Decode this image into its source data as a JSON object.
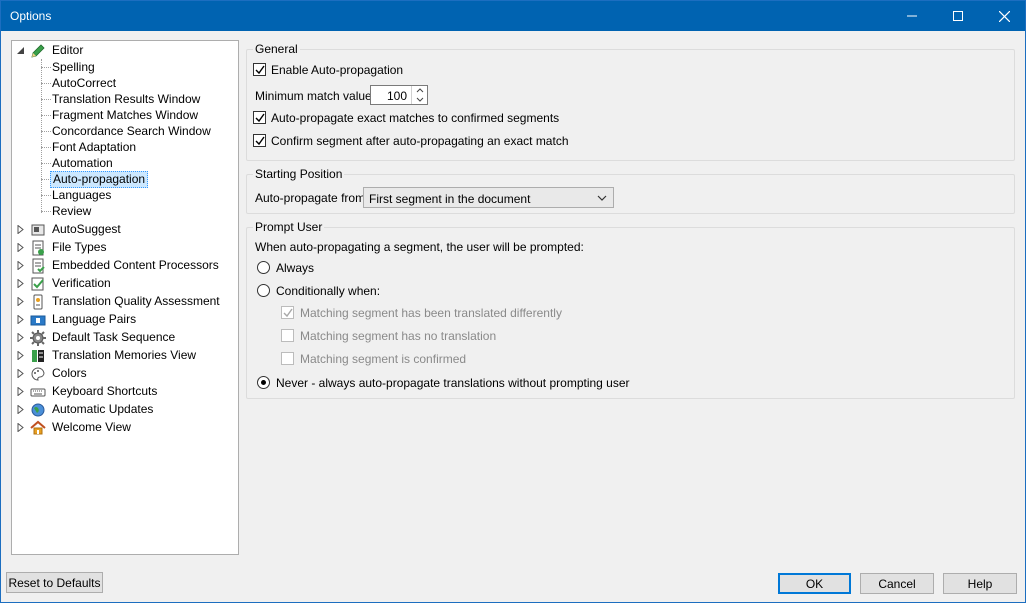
{
  "window": {
    "title": "Options"
  },
  "tree": {
    "editor": "Editor",
    "children": [
      "Spelling",
      "AutoCorrect",
      "Translation Results Window",
      "Fragment Matches Window",
      "Concordance Search Window",
      "Font Adaptation",
      "Automation",
      "Auto-propagation",
      "Languages",
      "Review"
    ],
    "selected_index": 7,
    "top_items": [
      {
        "label": "AutoSuggest",
        "icon": "autosuggest-icon"
      },
      {
        "label": "File Types",
        "icon": "file-types-icon"
      },
      {
        "label": "Embedded Content Processors",
        "icon": "embedded-content-icon"
      },
      {
        "label": "Verification",
        "icon": "verification-icon"
      },
      {
        "label": "Translation Quality Assessment",
        "icon": "quality-assessment-icon"
      },
      {
        "label": "Language Pairs",
        "icon": "language-pairs-icon"
      },
      {
        "label": "Default Task Sequence",
        "icon": "gear-icon"
      },
      {
        "label": "Translation Memories View",
        "icon": "translation-memories-icon"
      },
      {
        "label": "Colors",
        "icon": "palette-icon"
      },
      {
        "label": "Keyboard Shortcuts",
        "icon": "keyboard-icon"
      },
      {
        "label": "Automatic Updates",
        "icon": "globe-icon"
      },
      {
        "label": "Welcome View",
        "icon": "home-icon"
      }
    ]
  },
  "general": {
    "label": "General",
    "enable_label": "Enable Auto-propagation",
    "enable_checked": true,
    "min_match_label": "Minimum match value:",
    "min_match_value": "100",
    "exact_confirmed_label": "Auto-propagate exact matches to confirmed segments",
    "exact_confirmed_checked": true,
    "confirm_after_label": "Confirm segment after auto-propagating an exact match",
    "confirm_after_checked": true
  },
  "starting_position": {
    "label": "Starting Position",
    "from_label": "Auto-propagate from:",
    "from_value": "First segment in the document"
  },
  "prompt_user": {
    "label": "Prompt User",
    "intro": "When auto-propagating a segment, the user will be prompted:",
    "always": "Always",
    "conditionally": "Conditionally when:",
    "cond_translated_differently": "Matching segment has been translated differently",
    "cond_no_translation": "Matching segment has no translation",
    "cond_confirmed": "Matching segment is confirmed",
    "never": "Never - always auto-propagate translations without prompting user",
    "selected": "never"
  },
  "buttons": {
    "reset": "Reset to Defaults",
    "ok": "OK",
    "cancel": "Cancel",
    "help": "Help"
  },
  "colors": {
    "titlebar": "#0063b1",
    "accent": "#0078d7",
    "selection": "#cce8ff"
  }
}
